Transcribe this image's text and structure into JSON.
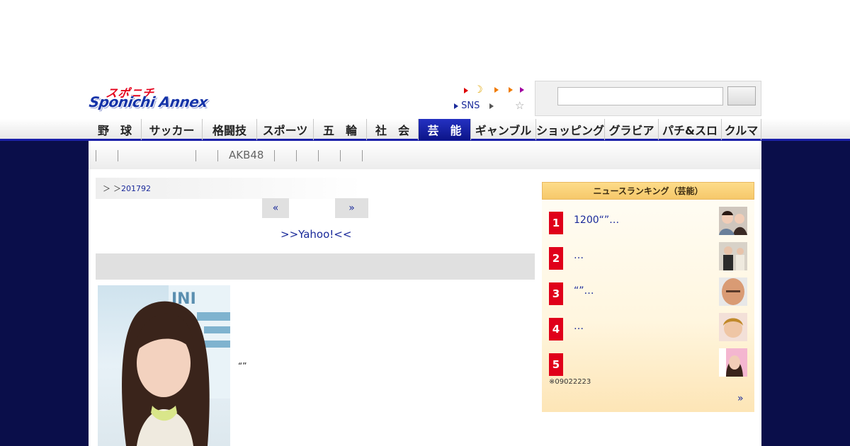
{
  "header": {
    "logo_kana": "スポニチ",
    "logo_main": "Sponichi Annex",
    "util_links": {
      "sns": "SNS"
    },
    "colors": {
      "brand_blue": "#1533a8",
      "brand_red": "#e4001b",
      "navy": "#0a0e4a"
    }
  },
  "search": {
    "input_value": "",
    "button_label": ""
  },
  "nav": {
    "items": [
      {
        "label": "野　球"
      },
      {
        "label": "サッカー"
      },
      {
        "label": "格闘技"
      },
      {
        "label": "スポーツ"
      },
      {
        "label": "五　輪"
      },
      {
        "label": "社　会"
      },
      {
        "label": "芸　能"
      },
      {
        "label": "ギャンブル"
      },
      {
        "label": "ショッピング"
      },
      {
        "label": "グラビア"
      },
      {
        "label": "パチ&スロ"
      },
      {
        "label": "クルマ"
      }
    ],
    "active_index": 6
  },
  "subnav": {
    "akb": "AKB48"
  },
  "breadcrumb": {
    "sep": "＞",
    "sep2": "＞",
    "date": "201792"
  },
  "pager": {
    "prev": "«",
    "next": "»"
  },
  "article": {
    "yahoo_link": ">>Yahoo!<<",
    "caption": "“”"
  },
  "ranking": {
    "title": "ニュースランキング（芸能）",
    "items": [
      {
        "rank": "1",
        "title": "1200“”…"
      },
      {
        "rank": "2",
        "title": "…"
      },
      {
        "rank": "3",
        "title": "“”…"
      },
      {
        "rank": "4",
        "title": "…"
      },
      {
        "rank": "5",
        "title": ""
      }
    ],
    "note": "※09022223",
    "more": "»"
  }
}
